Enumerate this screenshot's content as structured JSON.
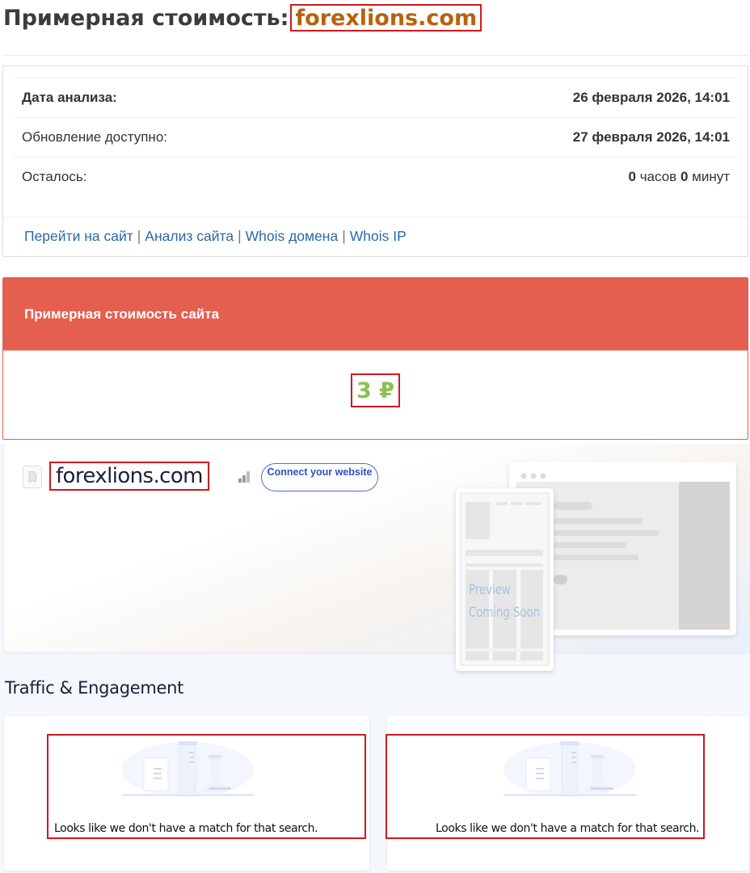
{
  "page": {
    "title_prefix": "Примерная стоимость:",
    "domain": "forexlions.com"
  },
  "analysis": {
    "rows": [
      {
        "label": "Дата анализа:",
        "value": "26 февраля 2026, 14:01"
      },
      {
        "label": "Обновление доступно:",
        "value": "27 февраля 2026, 14:01"
      }
    ],
    "remaining": {
      "label": "Осталось:",
      "hours": "0",
      "hours_unit": "часов",
      "minutes": "0",
      "minutes_unit": "минут"
    },
    "links": [
      "Перейти на сайт",
      "Анализ сайта",
      "Whois домена",
      "Whois IP"
    ],
    "link_separator": "|"
  },
  "cost": {
    "header": "Примерная стоимость сайта",
    "value": "3 ₽"
  },
  "similarweb": {
    "domain": "forexlions.com",
    "connect_button": "Connect your website",
    "preview_line1": "Preview",
    "preview_line2": "Coming Soon",
    "section_title": "Traffic & Engagement",
    "empty_message": "Looks like we don't have a match for that search."
  },
  "colors": {
    "brand_red": "#e45f50",
    "highlight_border": "#d0181d",
    "domain_orange": "#b8620d",
    "cost_green": "#8cc152",
    "link_blue": "#2a6aa8"
  },
  "icons": [
    "file-icon",
    "rank-bars-icon",
    "no-data-illustration-icon"
  ]
}
